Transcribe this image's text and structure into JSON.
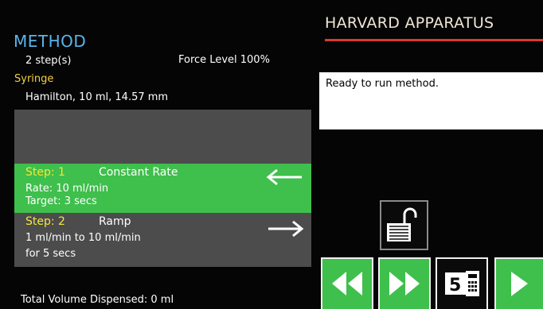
{
  "method": {
    "title": "METHOD",
    "steps_count": "2 step(s)",
    "force_level": "Force Level 100%",
    "syringe_label": "Syringe",
    "syringe_value": "Hamilton, 10 ml, 14.57 mm"
  },
  "steps": [
    {
      "number": "Step: 1",
      "type": "Constant Rate",
      "line1": "Rate: 10 ml/min",
      "line2": "Target: 3 secs",
      "arrow": "arrow-left-icon",
      "selected": true
    },
    {
      "number": "Step: 2",
      "type": "Ramp",
      "line1": "1 ml/min to  10 ml/min",
      "line2": "for 5 secs",
      "arrow": "arrow-right-icon",
      "selected": false
    }
  ],
  "total_volume": "Total Volume Dispensed: 0 ml",
  "brand": "HARVARD APPARATUS",
  "status": "Ready to run method.",
  "buttons": {
    "lock": "unlocked-padlock-icon",
    "rewind": "rewind-icon",
    "fast_forward": "fast-forward-icon",
    "method": "method-panel-icon",
    "run": "play-icon"
  },
  "colors": {
    "background": "#050505",
    "method_title": "#5ab4ec",
    "syringe_label": "#f3d13a",
    "selected_step": "#3fbf4c",
    "step_panel": "#4c4c4c",
    "step_number": "#f3e83a",
    "brand_underline": "#d93b30",
    "button_green": "#3fbf4c"
  }
}
